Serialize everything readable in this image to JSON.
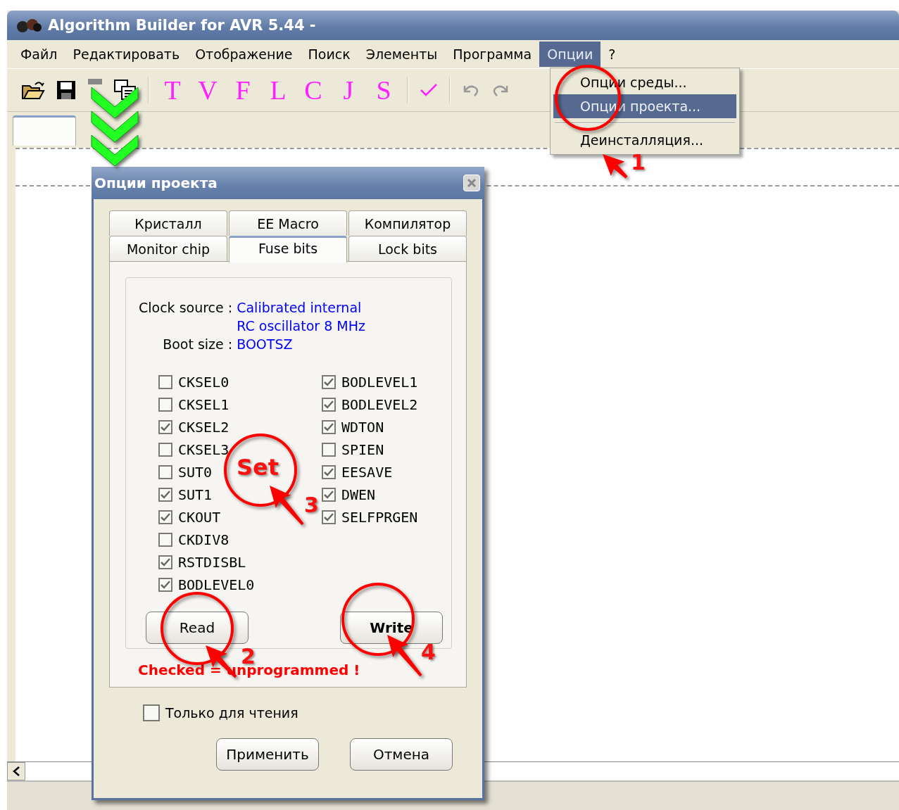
{
  "window": {
    "title": "Algorithm Builder for AVR 5.44 -"
  },
  "menu": [
    {
      "label": "Файл",
      "selected": false
    },
    {
      "label": "Редактировать",
      "selected": false
    },
    {
      "label": "Отображение",
      "selected": false
    },
    {
      "label": "Поиск",
      "selected": false
    },
    {
      "label": "Элементы",
      "selected": false
    },
    {
      "label": "Программа",
      "selected": false
    },
    {
      "label": "Опции",
      "selected": true
    },
    {
      "label": "?",
      "selected": false
    }
  ],
  "toolbar": {
    "letters": [
      "T",
      "V",
      "F",
      "L",
      "C",
      "J",
      "S"
    ]
  },
  "options_menu": {
    "items": [
      {
        "label": "Опции среды...",
        "selected": false,
        "separator_before": false
      },
      {
        "label": "Опции проекта...",
        "selected": true,
        "separator_before": false
      },
      {
        "label": "Деинсталляция...",
        "selected": false,
        "separator_before": true
      }
    ]
  },
  "dialog": {
    "title": "Опции проекта",
    "tab_rows": [
      [
        {
          "label": "Кристалл",
          "selected": false
        },
        {
          "label": "EE Macro",
          "selected": false
        },
        {
          "label": "Компилятор",
          "selected": false
        }
      ],
      [
        {
          "label": "Monitor chip",
          "selected": false
        },
        {
          "label": "Fuse bits",
          "selected": true
        },
        {
          "label": "Lock bits",
          "selected": false
        }
      ]
    ],
    "clock_source": {
      "label": "Clock source :",
      "value_lines": [
        "Calibrated internal",
        "RC oscillator 8 MHz"
      ]
    },
    "boot_size": {
      "label": "Boot size :",
      "value": "BOOTSZ"
    },
    "fuse_columns": [
      [
        {
          "label": "CKSEL0",
          "checked": false
        },
        {
          "label": "CKSEL1",
          "checked": false
        },
        {
          "label": "CKSEL2",
          "checked": true
        },
        {
          "label": "CKSEL3",
          "checked": false
        },
        {
          "label": "SUT0",
          "checked": false
        },
        {
          "label": "SUT1",
          "checked": true
        },
        {
          "label": "CKOUT",
          "checked": true
        },
        {
          "label": "CKDIV8",
          "checked": false
        },
        {
          "label": "RSTDISBL",
          "checked": true
        },
        {
          "label": "BODLEVEL0",
          "checked": true
        }
      ],
      [
        {
          "label": "BODLEVEL1",
          "checked": true
        },
        {
          "label": "BODLEVEL2",
          "checked": true
        },
        {
          "label": "WDTON",
          "checked": true
        },
        {
          "label": "SPIEN",
          "checked": false
        },
        {
          "label": "EESAVE",
          "checked": true
        },
        {
          "label": "DWEN",
          "checked": true
        },
        {
          "label": "SELFPRGEN",
          "checked": true
        }
      ]
    ],
    "read_button": "Read",
    "write_button": "Write",
    "read_only": {
      "label": "Только для чтения",
      "checked": false
    },
    "buttons": [
      "Применить",
      "Отмена"
    ]
  },
  "annotations": [
    {
      "number": "1"
    },
    {
      "number": "2"
    },
    {
      "number": "3",
      "label": "Set"
    },
    {
      "number": "4"
    }
  ],
  "note": "Checked = unprogrammed !"
}
